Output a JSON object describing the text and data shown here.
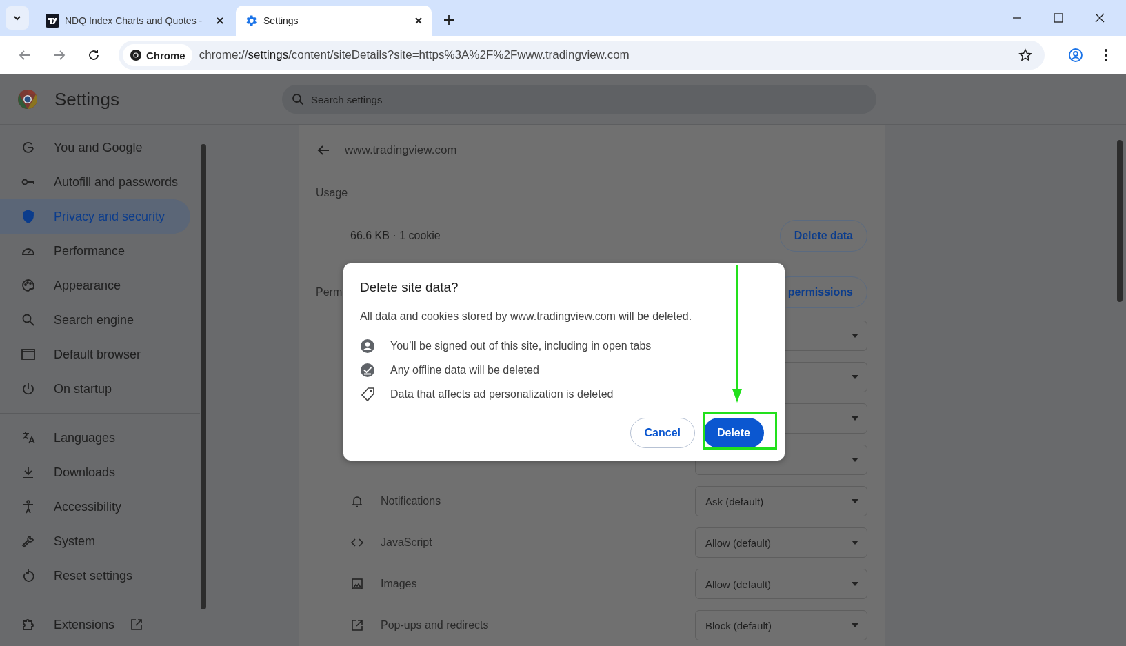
{
  "browser": {
    "tabs": [
      {
        "title": "NDQ Index Charts and Quotes -",
        "selected": false
      },
      {
        "title": "Settings",
        "selected": true
      }
    ],
    "omnibox": {
      "chip": "Chrome",
      "url": "chrome://**settings**/content/siteDetails?site=https%3A%2F%2Fwww.tradingview.com"
    }
  },
  "settings": {
    "title": "Settings",
    "search": {
      "placeholder": "Search settings"
    },
    "sidebar": {
      "groups": [
        [
          {
            "label": "You and Google",
            "selected": false
          },
          {
            "label": "Autofill and passwords",
            "selected": false
          },
          {
            "label": "Privacy and security",
            "selected": true
          },
          {
            "label": "Performance",
            "selected": false
          },
          {
            "label": "Appearance",
            "selected": false
          },
          {
            "label": "Search engine",
            "selected": false
          },
          {
            "label": "Default browser",
            "selected": false
          },
          {
            "label": "On startup",
            "selected": false
          }
        ],
        [
          {
            "label": "Languages",
            "selected": false
          },
          {
            "label": "Downloads",
            "selected": false
          },
          {
            "label": "Accessibility",
            "selected": false
          },
          {
            "label": "System",
            "selected": false
          },
          {
            "label": "Reset settings",
            "selected": false
          }
        ],
        [
          {
            "label": "Extensions",
            "selected": false
          }
        ]
      ]
    },
    "site": {
      "name": "www.tradingview.com",
      "usage_heading": "Usage",
      "usage": "66.6 KB · 1 cookie",
      "delete_button": "Delete data",
      "permissions_heading": "Perm",
      "reset_button": "permissions",
      "permissions": [
        {
          "label": "Notifications",
          "value": "Ask (default)"
        },
        {
          "label": "JavaScript",
          "value": "Allow (default)"
        },
        {
          "label": "Images",
          "value": "Allow (default)"
        },
        {
          "label": "Pop-ups and redirects",
          "value": "Block (default)"
        }
      ]
    }
  },
  "dialog": {
    "title": "Delete site data?",
    "message": "All data and cookies stored by www.tradingview.com will be deleted.",
    "items": [
      {
        "text": "You’ll be signed out of this site, including in open tabs"
      },
      {
        "text": "Any offline data will be deleted"
      },
      {
        "text": "Data that affects ad personalization is deleted"
      }
    ],
    "cancel": "Cancel",
    "confirm": "Delete"
  }
}
